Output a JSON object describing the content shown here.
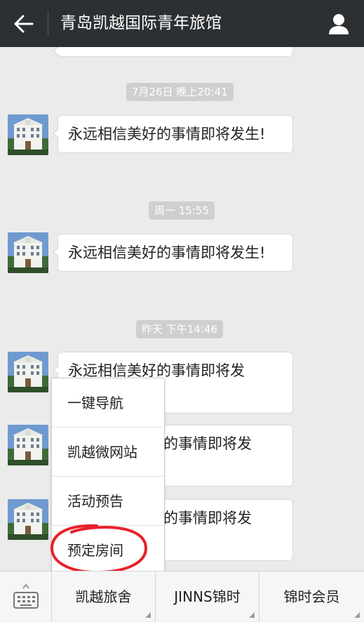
{
  "header": {
    "title": "青岛凯越国际青年旅馆",
    "back_icon": "arrow-left-icon",
    "profile_icon": "person-icon"
  },
  "chat": {
    "timestamps": [
      "7月26日 晚上20:41",
      "周一 15:55",
      "昨天 下午14:46"
    ],
    "messages": [
      "永远相信美好的事情即将发生!",
      "永远相信美好的事情即将发生!",
      "永远相信美好的事情即将发",
      "的事情即将发",
      "的事情即将发"
    ]
  },
  "popup_menu": {
    "items": [
      "一键导航",
      "凯越微网站",
      "活动预告",
      "预定房间"
    ],
    "highlighted_item": "预定房间",
    "highlight_color": "#e8202a"
  },
  "bottom_menu": {
    "keyboard_icon": "keyboard-icon",
    "buttons": [
      "凯越旅舍",
      "JINNS锦时",
      "锦时会员"
    ]
  },
  "colors": {
    "topbar": "#2d3033",
    "background": "#ebebeb",
    "bubble": "#ffffff"
  }
}
